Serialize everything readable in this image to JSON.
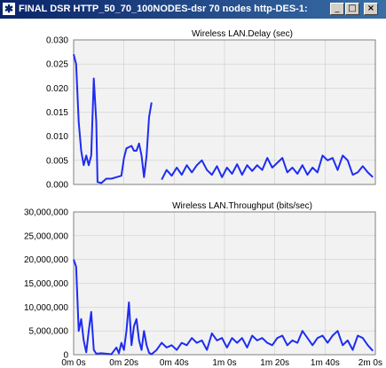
{
  "window": {
    "title": "FINAL DSR HTTP_50_70_100NODES-dsr 70 nodes http-DES-1:",
    "buttons": {
      "minimize": "_",
      "maximize": "□",
      "close": "×"
    },
    "icon": "app-icon"
  },
  "colors": {
    "series": "#1e2df0",
    "plot_bg": "#f2f2f2",
    "titlebar": "#0a246a"
  },
  "chart_data": [
    {
      "type": "line",
      "title": "Wireless LAN.Delay (sec)",
      "xlabel": "",
      "ylabel": "",
      "xlim": [
        0,
        120
      ],
      "ylim": [
        0,
        0.03
      ],
      "yticks": [
        0,
        0.005,
        0.01,
        0.015,
        0.02,
        0.025,
        0.03
      ],
      "ytick_labels": [
        "0.000",
        "0.005",
        "0.010",
        "0.015",
        "0.020",
        "0.025",
        "0.030"
      ],
      "xticks": [
        0,
        20,
        40,
        60,
        80,
        100,
        120
      ],
      "xtick_labels": [],
      "grid": true,
      "series": [
        {
          "segments": [
            [
              [
                0,
                0.027
              ],
              [
                1,
                0.025
              ],
              [
                2,
                0.013
              ],
              [
                3,
                0.007
              ],
              [
                4,
                0.004
              ],
              [
                5,
                0.006
              ],
              [
                6,
                0.004
              ],
              [
                7,
                0.006
              ],
              [
                8,
                0.022
              ],
              [
                9,
                0.013
              ],
              [
                9.5,
                0.0005
              ],
              [
                11,
                0.0003
              ],
              [
                13,
                0.0012
              ],
              [
                15,
                0.0012
              ],
              [
                17,
                0.0015
              ],
              [
                19,
                0.0018
              ],
              [
                20,
                0.0055
              ],
              [
                21,
                0.0075
              ],
              [
                23,
                0.008
              ],
              [
                24,
                0.007
              ],
              [
                25,
                0.007
              ],
              [
                26,
                0.0085
              ],
              [
                27,
                0.006
              ],
              [
                28,
                0.0015
              ],
              [
                29,
                0.006
              ],
              [
                30,
                0.014
              ],
              [
                31,
                0.017
              ]
            ],
            [
              [
                35,
                0.001
              ],
              [
                37,
                0.003
              ],
              [
                39,
                0.0018
              ],
              [
                41,
                0.0035
              ],
              [
                43,
                0.002
              ],
              [
                45,
                0.004
              ],
              [
                47,
                0.0025
              ],
              [
                49,
                0.004
              ],
              [
                51,
                0.005
              ],
              [
                53,
                0.003
              ],
              [
                55,
                0.002
              ],
              [
                57,
                0.0038
              ],
              [
                59,
                0.0015
              ],
              [
                61,
                0.0035
              ],
              [
                63,
                0.0022
              ],
              [
                65,
                0.0042
              ],
              [
                67,
                0.002
              ],
              [
                69,
                0.004
              ],
              [
                71,
                0.0028
              ],
              [
                73,
                0.004
              ],
              [
                75,
                0.003
              ],
              [
                77,
                0.0055
              ],
              [
                79,
                0.0035
              ],
              [
                81,
                0.0045
              ],
              [
                83,
                0.0055
              ],
              [
                85,
                0.0025
              ],
              [
                87,
                0.0035
              ],
              [
                89,
                0.0022
              ],
              [
                91,
                0.004
              ],
              [
                93,
                0.002
              ],
              [
                95,
                0.0035
              ],
              [
                97,
                0.0025
              ],
              [
                99,
                0.006
              ],
              [
                101,
                0.005
              ],
              [
                103,
                0.0055
              ],
              [
                105,
                0.003
              ],
              [
                107,
                0.006
              ],
              [
                109,
                0.005
              ],
              [
                111,
                0.002
              ],
              [
                113,
                0.0025
              ],
              [
                115,
                0.0038
              ],
              [
                117,
                0.0025
              ],
              [
                119,
                0.0015
              ]
            ]
          ]
        }
      ]
    },
    {
      "type": "line",
      "title": "Wireless LAN.Throughput (bits/sec)",
      "xlabel": "",
      "ylabel": "",
      "xlim": [
        0,
        120
      ],
      "ylim": [
        0,
        30000000
      ],
      "yticks": [
        0,
        5000000,
        10000000,
        15000000,
        20000000,
        25000000,
        30000000
      ],
      "ytick_labels": [
        "0",
        "5,000,000",
        "10,000,000",
        "15,000,000",
        "20,000,000",
        "25,000,000",
        "30,000,000"
      ],
      "xticks": [
        0,
        20,
        40,
        60,
        80,
        100,
        120
      ],
      "xtick_labels": [
        "0m 0s",
        "0m 20s",
        "0m 40s",
        "1m 0s",
        "1m 20s",
        "1m 40s",
        "2m 0s"
      ],
      "grid": true,
      "series": [
        {
          "segments": [
            [
              [
                0,
                20000000
              ],
              [
                1,
                18500000
              ],
              [
                2,
                5000000
              ],
              [
                3,
                7500000
              ],
              [
                4,
                3000000
              ],
              [
                5,
                500000
              ],
              [
                6,
                5000000
              ],
              [
                7,
                9000000
              ],
              [
                8,
                1000000
              ],
              [
                9,
                200000
              ],
              [
                11,
                300000
              ],
              [
                13,
                200000
              ],
              [
                15,
                100000
              ],
              [
                17,
                1500000
              ],
              [
                18,
                300000
              ],
              [
                19,
                2500000
              ],
              [
                20,
                1000000
              ],
              [
                21,
                5000000
              ],
              [
                22,
                11000000
              ],
              [
                23,
                2000000
              ],
              [
                24,
                6000000
              ],
              [
                25,
                7500000
              ],
              [
                26,
                3000000
              ],
              [
                27,
                1000000
              ],
              [
                28,
                5000000
              ],
              [
                29,
                2000000
              ],
              [
                30,
                400000
              ],
              [
                31,
                100000
              ],
              [
                33,
                1000000
              ],
              [
                35,
                2500000
              ],
              [
                37,
                1500000
              ],
              [
                39,
                2000000
              ],
              [
                41,
                1000000
              ],
              [
                43,
                2500000
              ],
              [
                45,
                2000000
              ],
              [
                47,
                3500000
              ],
              [
                49,
                2500000
              ],
              [
                51,
                3000000
              ],
              [
                53,
                1000000
              ],
              [
                55,
                4500000
              ],
              [
                57,
                3000000
              ],
              [
                59,
                3500000
              ],
              [
                61,
                1500000
              ],
              [
                63,
                3500000
              ],
              [
                65,
                2500000
              ],
              [
                67,
                3500000
              ],
              [
                69,
                1500000
              ],
              [
                71,
                4000000
              ],
              [
                73,
                3000000
              ],
              [
                75,
                3500000
              ],
              [
                77,
                2500000
              ],
              [
                79,
                2000000
              ],
              [
                81,
                3500000
              ],
              [
                83,
                4000000
              ],
              [
                85,
                2000000
              ],
              [
                87,
                3000000
              ],
              [
                89,
                2500000
              ],
              [
                91,
                5000000
              ],
              [
                93,
                3500000
              ],
              [
                95,
                2000000
              ],
              [
                97,
                3500000
              ],
              [
                99,
                4000000
              ],
              [
                101,
                2500000
              ],
              [
                103,
                4000000
              ],
              [
                105,
                5000000
              ],
              [
                107,
                2000000
              ],
              [
                109,
                3000000
              ],
              [
                111,
                1000000
              ],
              [
                113,
                4000000
              ],
              [
                115,
                3500000
              ],
              [
                117,
                2000000
              ],
              [
                119,
                800000
              ]
            ]
          ]
        }
      ]
    }
  ]
}
